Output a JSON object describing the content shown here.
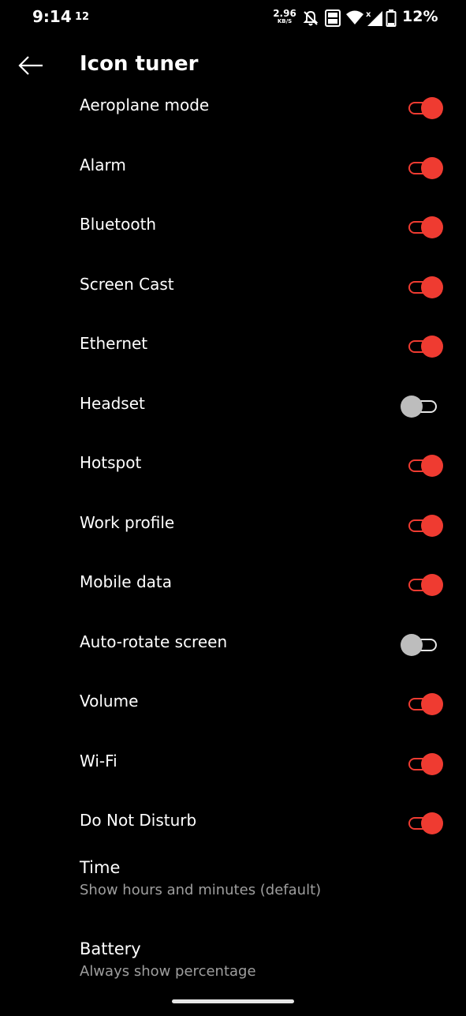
{
  "status_bar": {
    "time": "9:14",
    "notification_count": "12",
    "net_speed_value": "2.96",
    "net_speed_unit": "KB/S",
    "battery_percent": "12%",
    "icons": [
      "bell-off-icon",
      "volte-icon",
      "wifi-icon",
      "signal-icon",
      "battery-icon"
    ]
  },
  "app_bar": {
    "title": "Icon tuner",
    "back_icon": "arrow-left-icon"
  },
  "toggles": [
    {
      "label": "Aeroplane mode",
      "on": true
    },
    {
      "label": "Alarm",
      "on": true
    },
    {
      "label": "Bluetooth",
      "on": true
    },
    {
      "label": "Screen Cast",
      "on": true
    },
    {
      "label": "Ethernet",
      "on": true
    },
    {
      "label": "Headset",
      "on": false
    },
    {
      "label": "Hotspot",
      "on": true
    },
    {
      "label": "Work profile",
      "on": true
    },
    {
      "label": "Mobile data",
      "on": true
    },
    {
      "label": "Auto-rotate screen",
      "on": false
    },
    {
      "label": "Volume",
      "on": true
    },
    {
      "label": "Wi-Fi",
      "on": true
    },
    {
      "label": "Do Not Disturb",
      "on": true
    }
  ],
  "prefs": [
    {
      "title": "Time",
      "summary": "Show hours and minutes (default)"
    },
    {
      "title": "Battery",
      "summary": "Always show percentage"
    }
  ],
  "colors": {
    "accent": "#ef3b31",
    "background": "#000000",
    "off_thumb": "#bdbdbd"
  }
}
